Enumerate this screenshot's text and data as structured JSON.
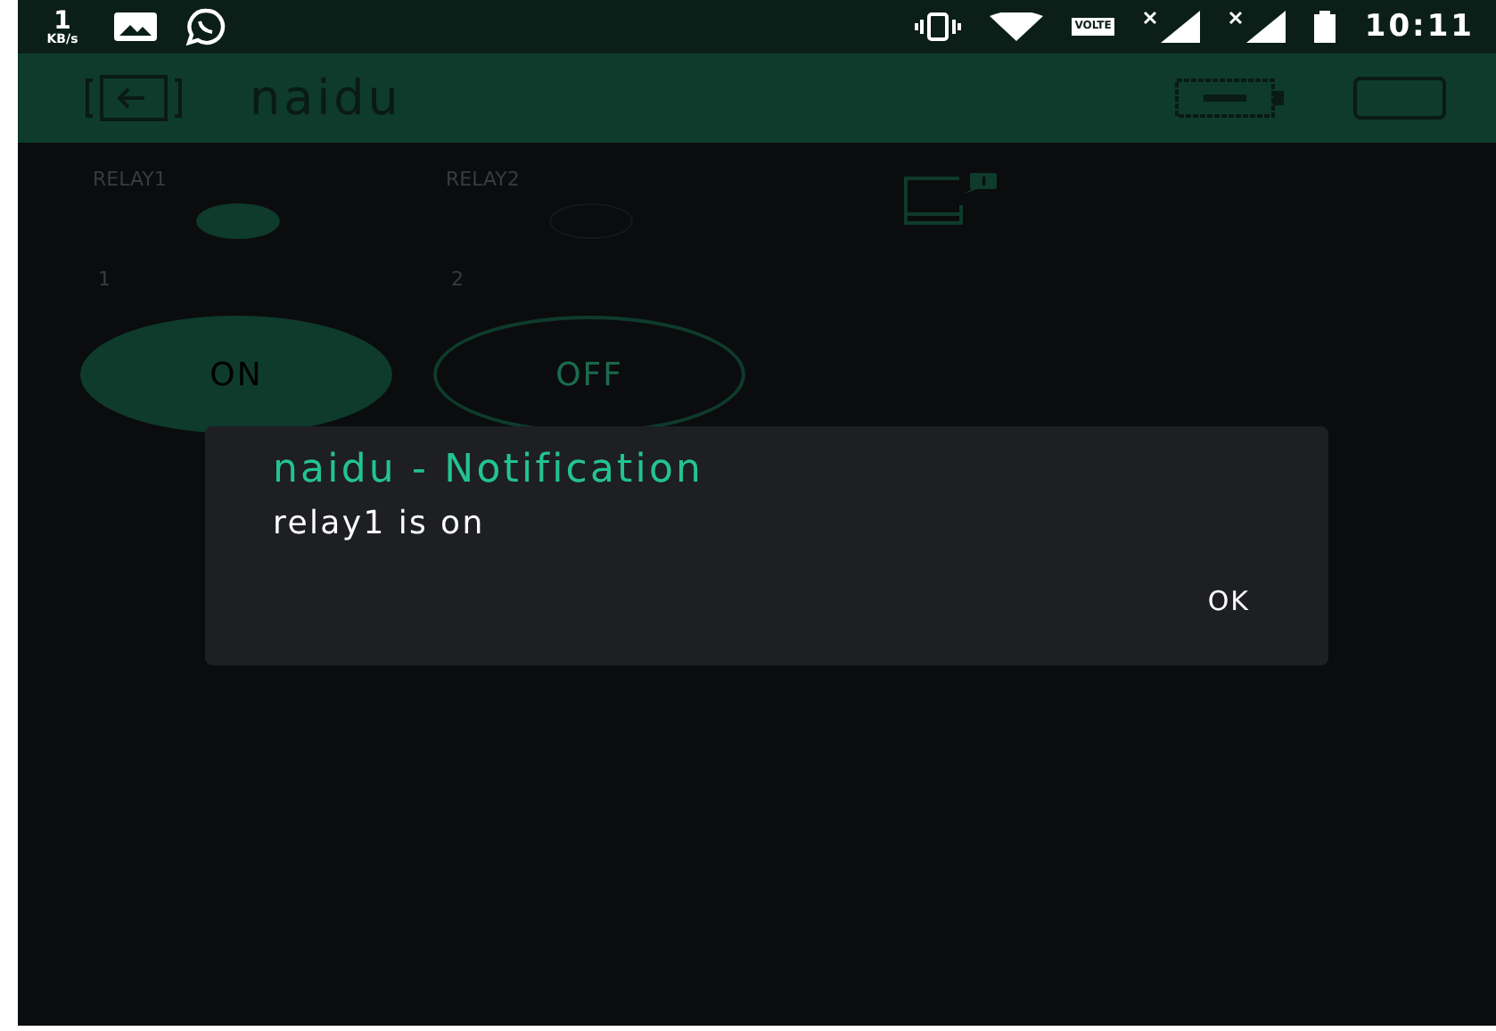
{
  "status_bar": {
    "speed_value": "1",
    "speed_unit": "KB/s",
    "network_badge": "VOLTE",
    "time": "10:11"
  },
  "app_bar": {
    "title": "naidu"
  },
  "widgets": {
    "leds": [
      {
        "label": "RELAY1",
        "on": true
      },
      {
        "label": "RELAY2",
        "on": false
      }
    ],
    "buttons": [
      {
        "label": "1",
        "text": "ON",
        "on": true
      },
      {
        "label": "2",
        "text": "OFF",
        "on": false
      }
    ]
  },
  "dialog": {
    "title": "naidu - Notification",
    "message": "relay1 is on",
    "button": "OK"
  }
}
